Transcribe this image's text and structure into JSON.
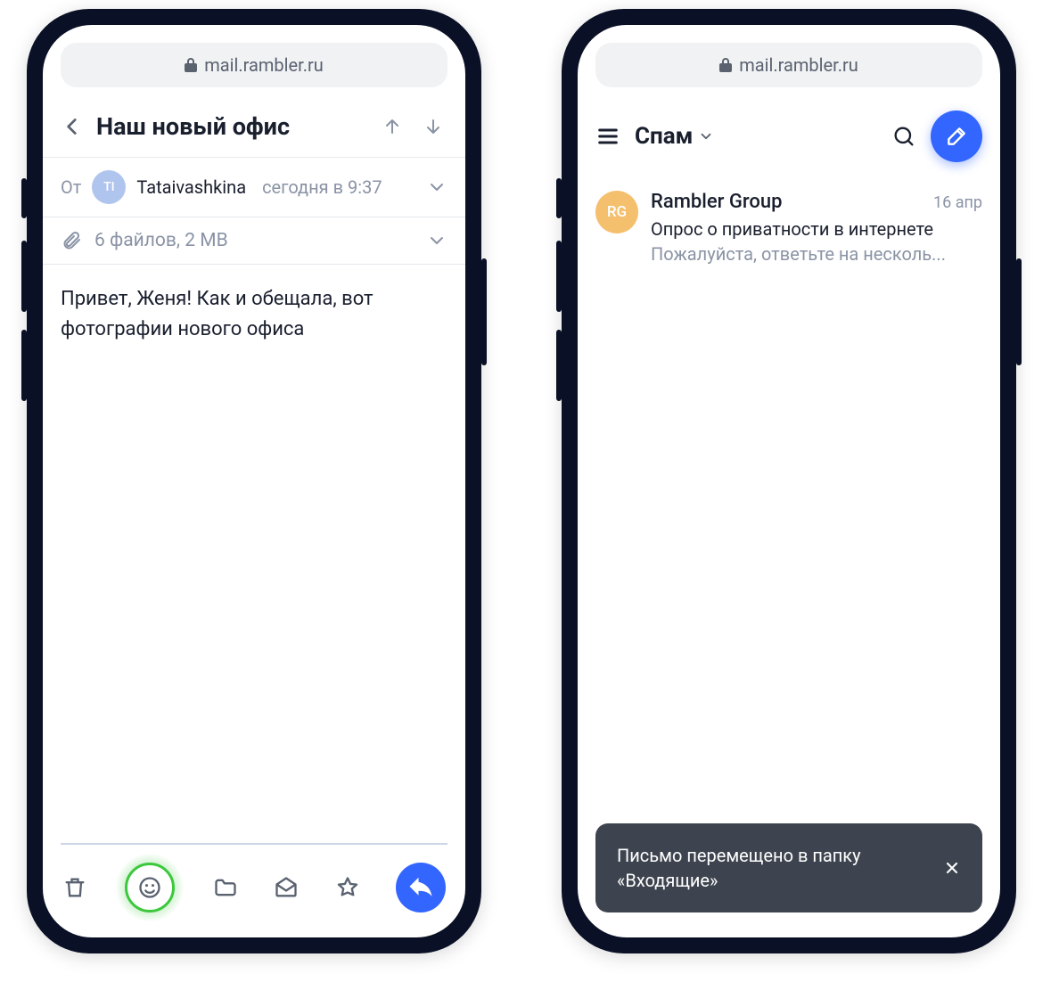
{
  "left": {
    "address_bar": {
      "url": "mail.rambler.ru"
    },
    "header": {
      "subject": "Наш новый офис"
    },
    "from": {
      "label": "От",
      "avatar_initials": "TI",
      "sender_name": "Tataivashkina",
      "time": "сегодня в 9:37"
    },
    "attachments": {
      "summary": "6 файлов, 2 MB"
    },
    "body": "Привет, Женя! Как и обещала, вот фотографии нового офиса"
  },
  "right": {
    "address_bar": {
      "url": "mail.rambler.ru"
    },
    "folder": {
      "title": "Спам"
    },
    "items": [
      {
        "avatar_initials": "RG",
        "sender": "Rambler Group",
        "date": "16 апр",
        "subject": "Опрос о приватности в интернете",
        "preview": "Пожалуйста, ответьте на несколь..."
      }
    ],
    "toast": {
      "text": "Письмо перемещено в папку «Входящие»"
    }
  }
}
